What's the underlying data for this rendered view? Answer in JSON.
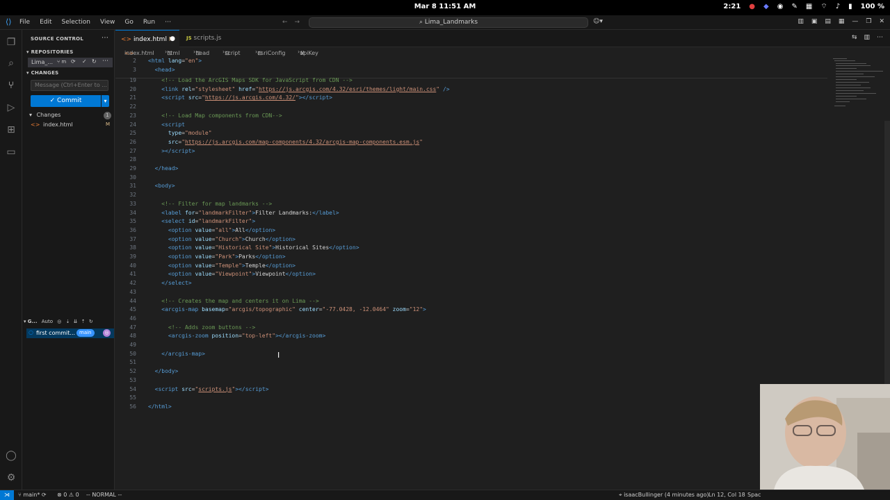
{
  "os_bar": {
    "clock": "Mar 8  11:51 AM",
    "time_right": "2:21",
    "battery": "100 %"
  },
  "menu": [
    "File",
    "Edit",
    "Selection",
    "View",
    "Go",
    "Run",
    "⋯"
  ],
  "command_center": "Lima_Landmarks",
  "sidebar": {
    "title": "SOURCE CONTROL",
    "repositories_header": "REPOSITORIES",
    "repo_name": "Lima_...",
    "repo_branch": "⑂ m",
    "changes_header": "CHANGES",
    "message_placeholder": "Message (Ctrl+Enter to ...",
    "commit_label": "Commit",
    "changes_group": "Changes",
    "changes_count": "1",
    "changed_file": "index.html",
    "changed_file_status": "M",
    "graph_header": "G...",
    "graph_auto": "Auto",
    "commit_message": "first commit...",
    "branch_badge": "main"
  },
  "tabs": [
    {
      "label": "index.html",
      "status": "M",
      "active": true
    },
    {
      "label": "scripts.js",
      "status": "",
      "active": false
    }
  ],
  "breadcrumbs": [
    "index.html",
    "html",
    "head",
    "script",
    "esriConfig",
    "apiKey"
  ],
  "code": {
    "sticky": [
      {
        "n": "2",
        "html": "<span class=\"tg\">&lt;html</span> <span class=\"at\">lang</span>=<span class=\"st\">\"en\"</span><span class=\"tg\">&gt;</span>"
      },
      {
        "n": "3",
        "html": "  <span class=\"tg\">&lt;head&gt;</span>"
      }
    ],
    "lines": [
      {
        "n": "19",
        "html": "    <span class=\"cm\">&lt;!-- Load the ArcGIS Maps SDK for JavaScript from CDN --&gt;</span>"
      },
      {
        "n": "20",
        "html": "    <span class=\"tg\">&lt;link</span> <span class=\"at\">rel</span>=<span class=\"st\">\"stylesheet\"</span> <span class=\"at\">href</span>=<span class=\"st\">\"</span><span class=\"un\">https://js.arcgis.com/4.32/esri/themes/light/main.css</span><span class=\"st\">\"</span> <span class=\"tg\">/&gt;</span>"
      },
      {
        "n": "21",
        "html": "    <span class=\"tg\">&lt;script</span> <span class=\"at\">src</span>=<span class=\"st\">\"</span><span class=\"un\">https://js.arcgis.com/4.32/</span><span class=\"st\">\"</span><span class=\"tg\">&gt;&lt;/script&gt;</span>"
      },
      {
        "n": "22",
        "html": ""
      },
      {
        "n": "23",
        "html": "    <span class=\"cm\">&lt;!-- Load Map components from CDN--&gt;</span>"
      },
      {
        "n": "24",
        "html": "    <span class=\"tg\">&lt;script</span>"
      },
      {
        "n": "25",
        "html": "      <span class=\"at\">type</span>=<span class=\"st\">\"module\"</span>"
      },
      {
        "n": "26",
        "html": "      <span class=\"at\">src</span>=<span class=\"st\">\"</span><span class=\"un\">https://js.arcgis.com/map-components/4.32/arcgis-map-components.esm.js</span><span class=\"st\">\"</span>"
      },
      {
        "n": "27",
        "html": "    <span class=\"tg\">&gt;&lt;/script&gt;</span>"
      },
      {
        "n": "28",
        "html": ""
      },
      {
        "n": "29",
        "html": "  <span class=\"tg\">&lt;/head&gt;</span>"
      },
      {
        "n": "30",
        "html": ""
      },
      {
        "n": "31",
        "html": "  <span class=\"tg\">&lt;body&gt;</span>"
      },
      {
        "n": "32",
        "html": ""
      },
      {
        "n": "33",
        "html": "    <span class=\"cm\">&lt;!-- Filter for map landmarks --&gt;</span>"
      },
      {
        "n": "34",
        "html": "    <span class=\"tg\">&lt;label</span> <span class=\"at\">for</span>=<span class=\"st\">\"landmarkFilter\"</span><span class=\"tg\">&gt;</span><span class=\"tx\">Filter Landmarks:</span><span class=\"tg\">&lt;/label&gt;</span>"
      },
      {
        "n": "35",
        "html": "    <span class=\"tg\">&lt;select</span> <span class=\"at\">id</span>=<span class=\"st\">\"landmarkFilter\"</span><span class=\"tg\">&gt;</span>"
      },
      {
        "n": "36",
        "html": "      <span class=\"tg\">&lt;option</span> <span class=\"at\">value</span>=<span class=\"st\">\"all\"</span><span class=\"tg\">&gt;</span><span class=\"tx\">All</span><span class=\"tg\">&lt;/option&gt;</span>"
      },
      {
        "n": "37",
        "html": "      <span class=\"tg\">&lt;option</span> <span class=\"at\">value</span>=<span class=\"st\">\"Church\"</span><span class=\"tg\">&gt;</span><span class=\"tx\">Church</span><span class=\"tg\">&lt;/option&gt;</span>"
      },
      {
        "n": "38",
        "html": "      <span class=\"tg\">&lt;option</span> <span class=\"at\">value</span>=<span class=\"st\">\"Historical Site\"</span><span class=\"tg\">&gt;</span><span class=\"tx\">Historical Sites</span><span class=\"tg\">&lt;/option&gt;</span>"
      },
      {
        "n": "39",
        "html": "      <span class=\"tg\">&lt;option</span> <span class=\"at\">value</span>=<span class=\"st\">\"Park\"</span><span class=\"tg\">&gt;</span><span class=\"tx\">Parks</span><span class=\"tg\">&lt;/option&gt;</span>"
      },
      {
        "n": "40",
        "html": "      <span class=\"tg\">&lt;option</span> <span class=\"at\">value</span>=<span class=\"st\">\"Temple\"</span><span class=\"tg\">&gt;</span><span class=\"tx\">Temple</span><span class=\"tg\">&lt;/option&gt;</span>"
      },
      {
        "n": "41",
        "html": "      <span class=\"tg\">&lt;option</span> <span class=\"at\">value</span>=<span class=\"st\">\"Viewpoint\"</span><span class=\"tg\">&gt;</span><span class=\"tx\">Viewpoint</span><span class=\"tg\">&lt;/option&gt;</span>"
      },
      {
        "n": "42",
        "html": "    <span class=\"tg\">&lt;/select&gt;</span>"
      },
      {
        "n": "43",
        "html": ""
      },
      {
        "n": "44",
        "html": "    <span class=\"cm\">&lt;!-- Creates the map and centers it on Lima --&gt;</span>"
      },
      {
        "n": "45",
        "html": "    <span class=\"tg\">&lt;arcgis-map</span> <span class=\"at\">basemap</span>=<span class=\"st\">\"arcgis/topographic\"</span> <span class=\"at\">center</span>=<span class=\"st\">\"-77.0428, -12.0464\"</span> <span class=\"at\">zoom</span>=<span class=\"st\">\"12\"</span><span class=\"tg\">&gt;</span>"
      },
      {
        "n": "46",
        "html": ""
      },
      {
        "n": "47",
        "html": "      <span class=\"cm\">&lt;!-- Adds zoom buttons --&gt;</span>"
      },
      {
        "n": "48",
        "html": "      <span class=\"tg\">&lt;arcgis-zoom</span> <span class=\"at\">position</span>=<span class=\"st\">\"top-left\"</span><span class=\"tg\">&gt;&lt;/arcgis-zoom&gt;</span>"
      },
      {
        "n": "49",
        "html": ""
      },
      {
        "n": "50",
        "html": "    <span class=\"tg\">&lt;/arcgis-map&gt;</span>"
      },
      {
        "n": "51",
        "html": ""
      },
      {
        "n": "52",
        "html": "  <span class=\"tg\">&lt;/body&gt;</span>"
      },
      {
        "n": "53",
        "html": ""
      },
      {
        "n": "54",
        "html": "  <span class=\"tg\">&lt;script</span> <span class=\"at\">src</span>=<span class=\"st\">\"</span><span class=\"un\">scripts.js</span><span class=\"st\">\"</span><span class=\"tg\">&gt;&lt;/script&gt;</span>"
      },
      {
        "n": "55",
        "html": ""
      },
      {
        "n": "56",
        "html": "<span class=\"tg\">&lt;/html&gt;</span>"
      }
    ]
  },
  "status": {
    "branch": "main*",
    "problems": "⊗ 0 ⚠ 0",
    "mode": "-- NORMAL --",
    "blame": "isaacBullinger (4 minutes ago)",
    "cursor": "Ln 12, Col 18",
    "spaces": "Spac"
  }
}
